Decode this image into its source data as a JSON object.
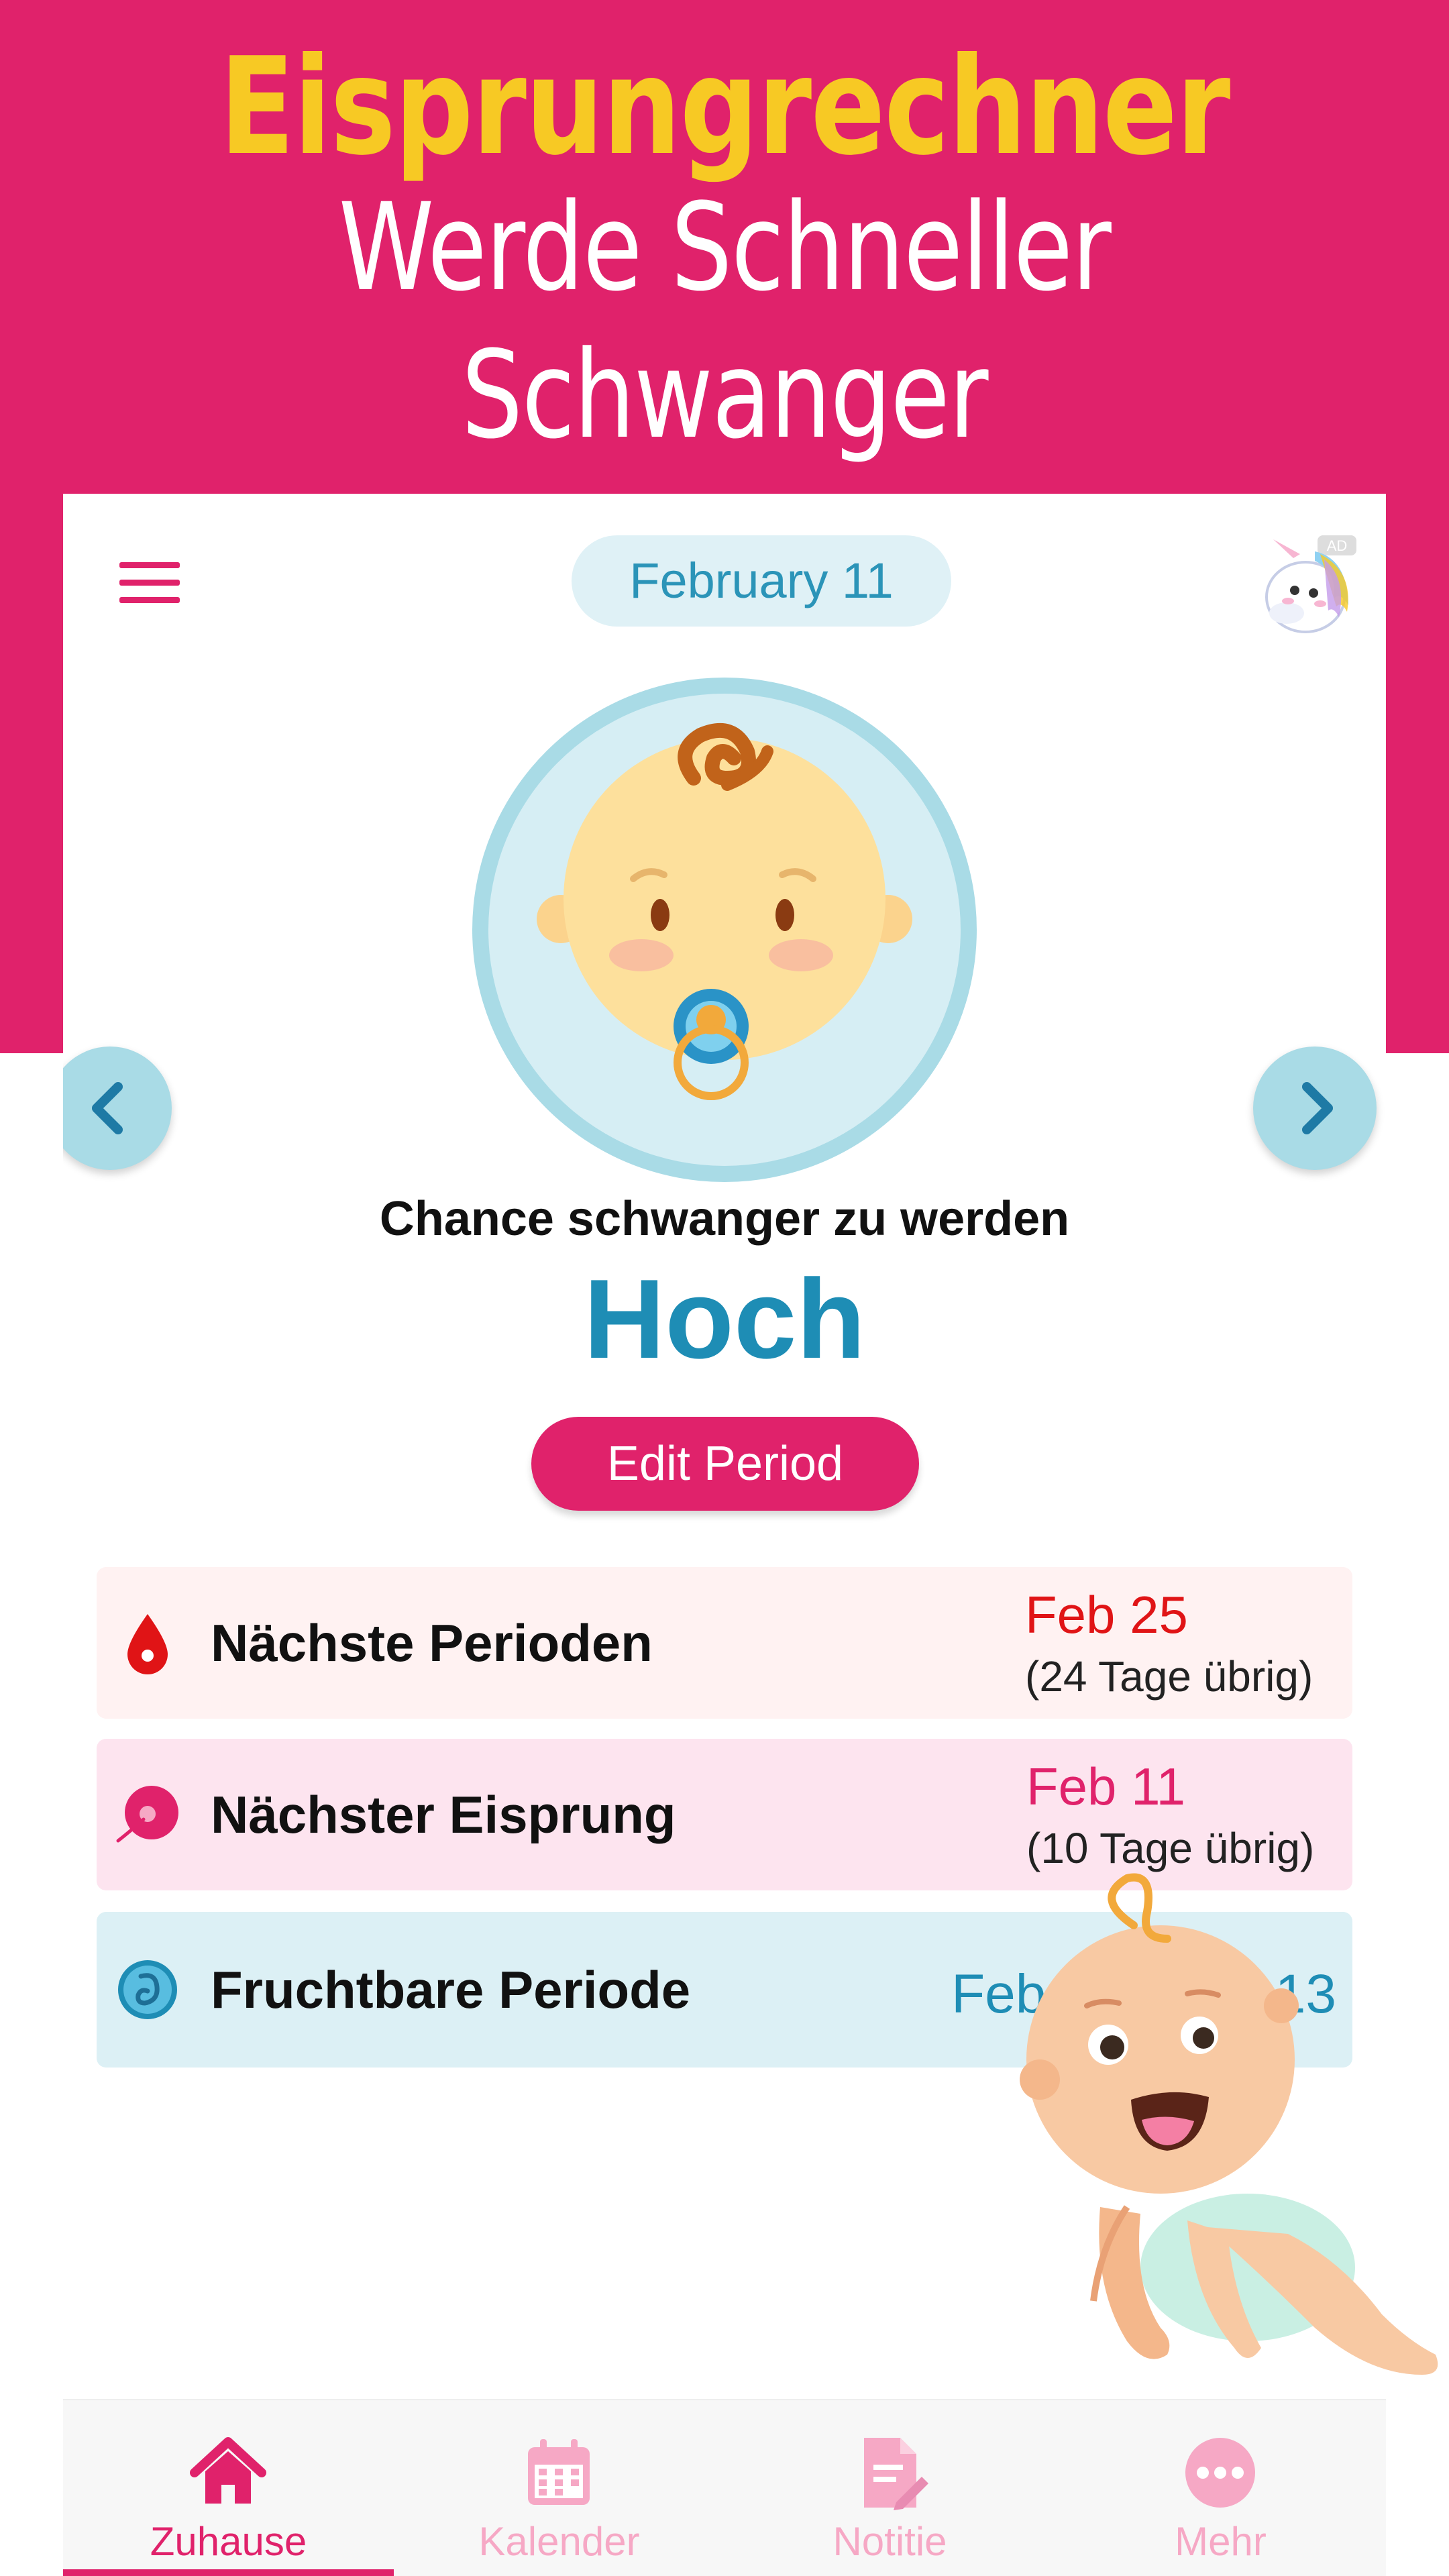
{
  "promo": {
    "headline": "Eisprungrechner",
    "subheadline": "Werde Schneller Schwanger"
  },
  "header": {
    "date": "February  11",
    "ad_badge": "AD",
    "menu_icon": "hamburger-menu-icon"
  },
  "status": {
    "chance_label": "Chance schwanger zu werden",
    "chance_value": "Hoch"
  },
  "actions": {
    "edit_period": "Edit Period"
  },
  "cards": [
    {
      "icon": "blood-drop-icon",
      "title": "Nächste Perioden",
      "date": "Feb 25",
      "days_left": "(24 Tage übrig)"
    },
    {
      "icon": "ovum-icon",
      "title": "Nächster Eisprung",
      "date": "Feb 11",
      "days_left": "(10 Tage übrig)"
    },
    {
      "icon": "fetus-icon",
      "title": "Fruchtbare Periode",
      "range_start": "Feb 09",
      "range_sep": "-",
      "range_end": "Feb 13"
    }
  ],
  "tabs": [
    {
      "label": "Zuhause",
      "icon": "home-icon",
      "active": true
    },
    {
      "label": "Kalender",
      "icon": "calendar-icon",
      "active": false
    },
    {
      "label": "Notitie",
      "icon": "note-icon",
      "active": false
    },
    {
      "label": "Mehr",
      "icon": "more-icon",
      "active": false
    }
  ],
  "colors": {
    "brand_pink": "#e0226b",
    "accent_yellow": "#f7c924",
    "accent_blue": "#1e8db5",
    "period_red": "#e01416"
  }
}
